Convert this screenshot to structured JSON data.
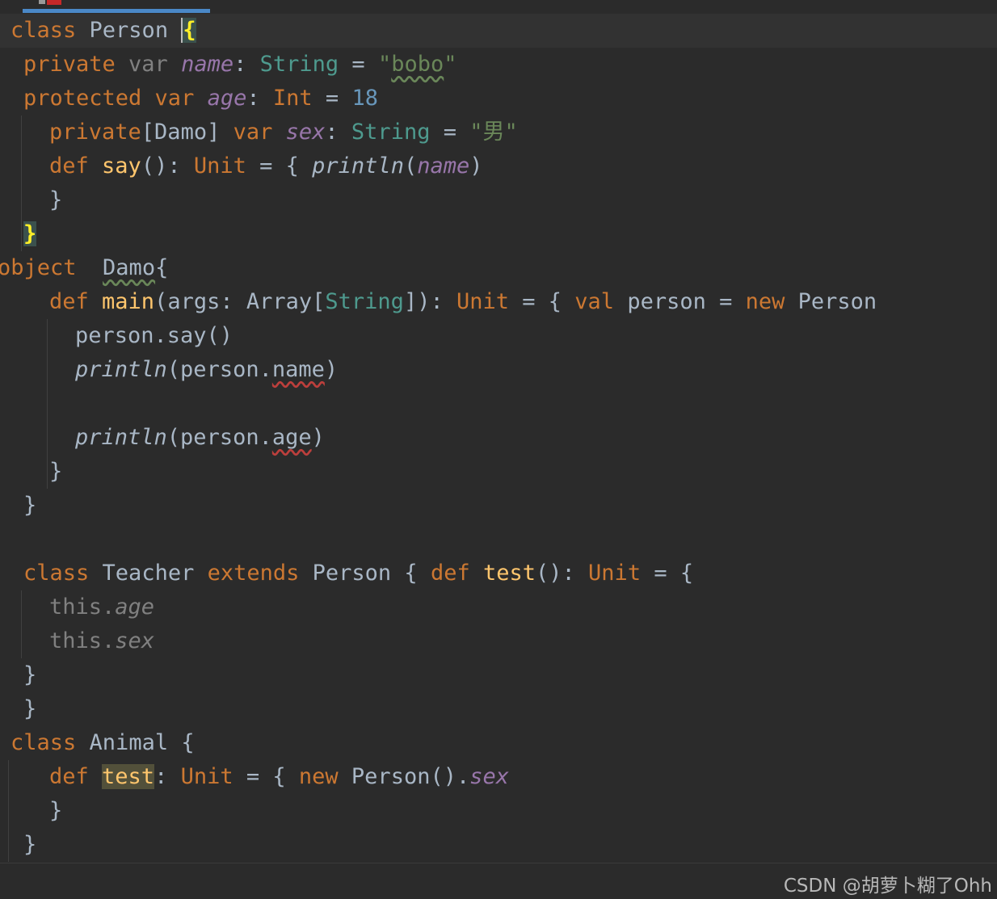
{
  "editor": {
    "language": "scala",
    "theme": "darcula",
    "lines": [
      {
        "indent": 13,
        "tokens": [
          {
            "t": "class",
            "c": "kw"
          },
          {
            "t": " Person "
          },
          {
            "t": "{",
            "c": "brace-match caret"
          }
        ]
      },
      {
        "indent": 29,
        "tokens": [
          {
            "t": "private ",
            "c": "kw"
          },
          {
            "t": "var ",
            "c": "dim"
          },
          {
            "t": "name",
            "c": "field"
          },
          {
            "t": ": "
          },
          {
            "t": "String",
            "c": "typ"
          },
          {
            "t": " = "
          },
          {
            "t": "\"",
            "c": "str"
          },
          {
            "t": "bobo",
            "c": "str wavy-g"
          },
          {
            "t": "\"",
            "c": "str"
          }
        ]
      },
      {
        "indent": 29,
        "tokens": [
          {
            "t": "protected var ",
            "c": "kw"
          },
          {
            "t": "age",
            "c": "field"
          },
          {
            "t": ": "
          },
          {
            "t": "Int",
            "c": "kw"
          },
          {
            "t": " = "
          },
          {
            "t": "18",
            "c": "num"
          }
        ]
      },
      {
        "indent": 61,
        "tokens": [
          {
            "t": "private",
            "c": "kw"
          },
          {
            "t": "[Damo] "
          },
          {
            "t": "var ",
            "c": "kw"
          },
          {
            "t": "sex",
            "c": "field"
          },
          {
            "t": ": "
          },
          {
            "t": "String",
            "c": "typ"
          },
          {
            "t": " = "
          },
          {
            "t": "\"男\"",
            "c": "str"
          }
        ]
      },
      {
        "indent": 61,
        "tokens": [
          {
            "t": "def ",
            "c": "kw"
          },
          {
            "t": "say",
            "c": "fn"
          },
          {
            "t": "(): "
          },
          {
            "t": "Unit",
            "c": "kw"
          },
          {
            "t": " = { "
          },
          {
            "t": "println",
            "c": "it"
          },
          {
            "t": "("
          },
          {
            "t": "name",
            "c": "field"
          },
          {
            "t": ")"
          }
        ]
      },
      {
        "indent": 61,
        "tokens": [
          {
            "t": "}"
          }
        ]
      },
      {
        "indent": 29,
        "tokens": [
          {
            "t": "}",
            "c": "brace-match"
          }
        ]
      },
      {
        "indent": -3,
        "tokens": [
          {
            "t": "object  ",
            "c": "kw"
          },
          {
            "t": "Damo",
            "c": "wavy-g"
          },
          {
            "t": "{"
          }
        ]
      },
      {
        "indent": 61,
        "tokens": [
          {
            "t": "def ",
            "c": "kw"
          },
          {
            "t": "main",
            "c": "fn"
          },
          {
            "t": "(args: Array["
          },
          {
            "t": "String",
            "c": "typ"
          },
          {
            "t": "]): "
          },
          {
            "t": "Unit",
            "c": "kw"
          },
          {
            "t": " = { "
          },
          {
            "t": "val ",
            "c": "kw"
          },
          {
            "t": "person = "
          },
          {
            "t": "new ",
            "c": "kw"
          },
          {
            "t": "Person"
          }
        ]
      },
      {
        "indent": 93,
        "tokens": [
          {
            "t": "person.say()"
          }
        ]
      },
      {
        "indent": 93,
        "tokens": [
          {
            "t": "println",
            "c": "it"
          },
          {
            "t": "(person."
          },
          {
            "t": "name",
            "c": "wavy-r"
          },
          {
            "t": ")"
          }
        ]
      },
      {
        "indent": 93,
        "tokens": []
      },
      {
        "indent": 93,
        "tokens": [
          {
            "t": "println",
            "c": "it"
          },
          {
            "t": "(person."
          },
          {
            "t": "age",
            "c": "wavy-r"
          },
          {
            "t": ")"
          }
        ]
      },
      {
        "indent": 61,
        "tokens": [
          {
            "t": "}"
          }
        ]
      },
      {
        "indent": 29,
        "tokens": [
          {
            "t": "}"
          }
        ]
      },
      {
        "indent": 29,
        "tokens": []
      },
      {
        "indent": 29,
        "tokens": [
          {
            "t": "class ",
            "c": "kw"
          },
          {
            "t": "Teacher "
          },
          {
            "t": "extends ",
            "c": "kw"
          },
          {
            "t": "Person { "
          },
          {
            "t": "def ",
            "c": "kw"
          },
          {
            "t": "test",
            "c": "fn"
          },
          {
            "t": "(): "
          },
          {
            "t": "Unit",
            "c": "kw"
          },
          {
            "t": " = {"
          }
        ]
      },
      {
        "indent": 61,
        "tokens": [
          {
            "t": "this.",
            "c": "dim"
          },
          {
            "t": "age",
            "c": "dimf"
          }
        ]
      },
      {
        "indent": 61,
        "tokens": [
          {
            "t": "this.",
            "c": "dim"
          },
          {
            "t": "sex",
            "c": "dimf"
          }
        ]
      },
      {
        "indent": 29,
        "tokens": [
          {
            "t": "}"
          }
        ]
      },
      {
        "indent": 29,
        "tokens": [
          {
            "t": "}"
          }
        ]
      },
      {
        "indent": 13,
        "tokens": [
          {
            "t": "class ",
            "c": "kw"
          },
          {
            "t": "Animal {"
          }
        ]
      },
      {
        "indent": 61,
        "tokens": [
          {
            "t": "def ",
            "c": "kw"
          },
          {
            "t": "test",
            "c": "fn usage-hl"
          },
          {
            "t": ": "
          },
          {
            "t": "Unit",
            "c": "kw"
          },
          {
            "t": " = { "
          },
          {
            "t": "new ",
            "c": "kw"
          },
          {
            "t": "Person()."
          },
          {
            "t": "sex",
            "c": "field"
          }
        ]
      },
      {
        "indent": 61,
        "tokens": [
          {
            "t": "}"
          }
        ]
      },
      {
        "indent": 29,
        "tokens": [
          {
            "t": "}"
          }
        ]
      }
    ]
  },
  "watermark": "CSDN @胡萝卜糊了Ohh"
}
